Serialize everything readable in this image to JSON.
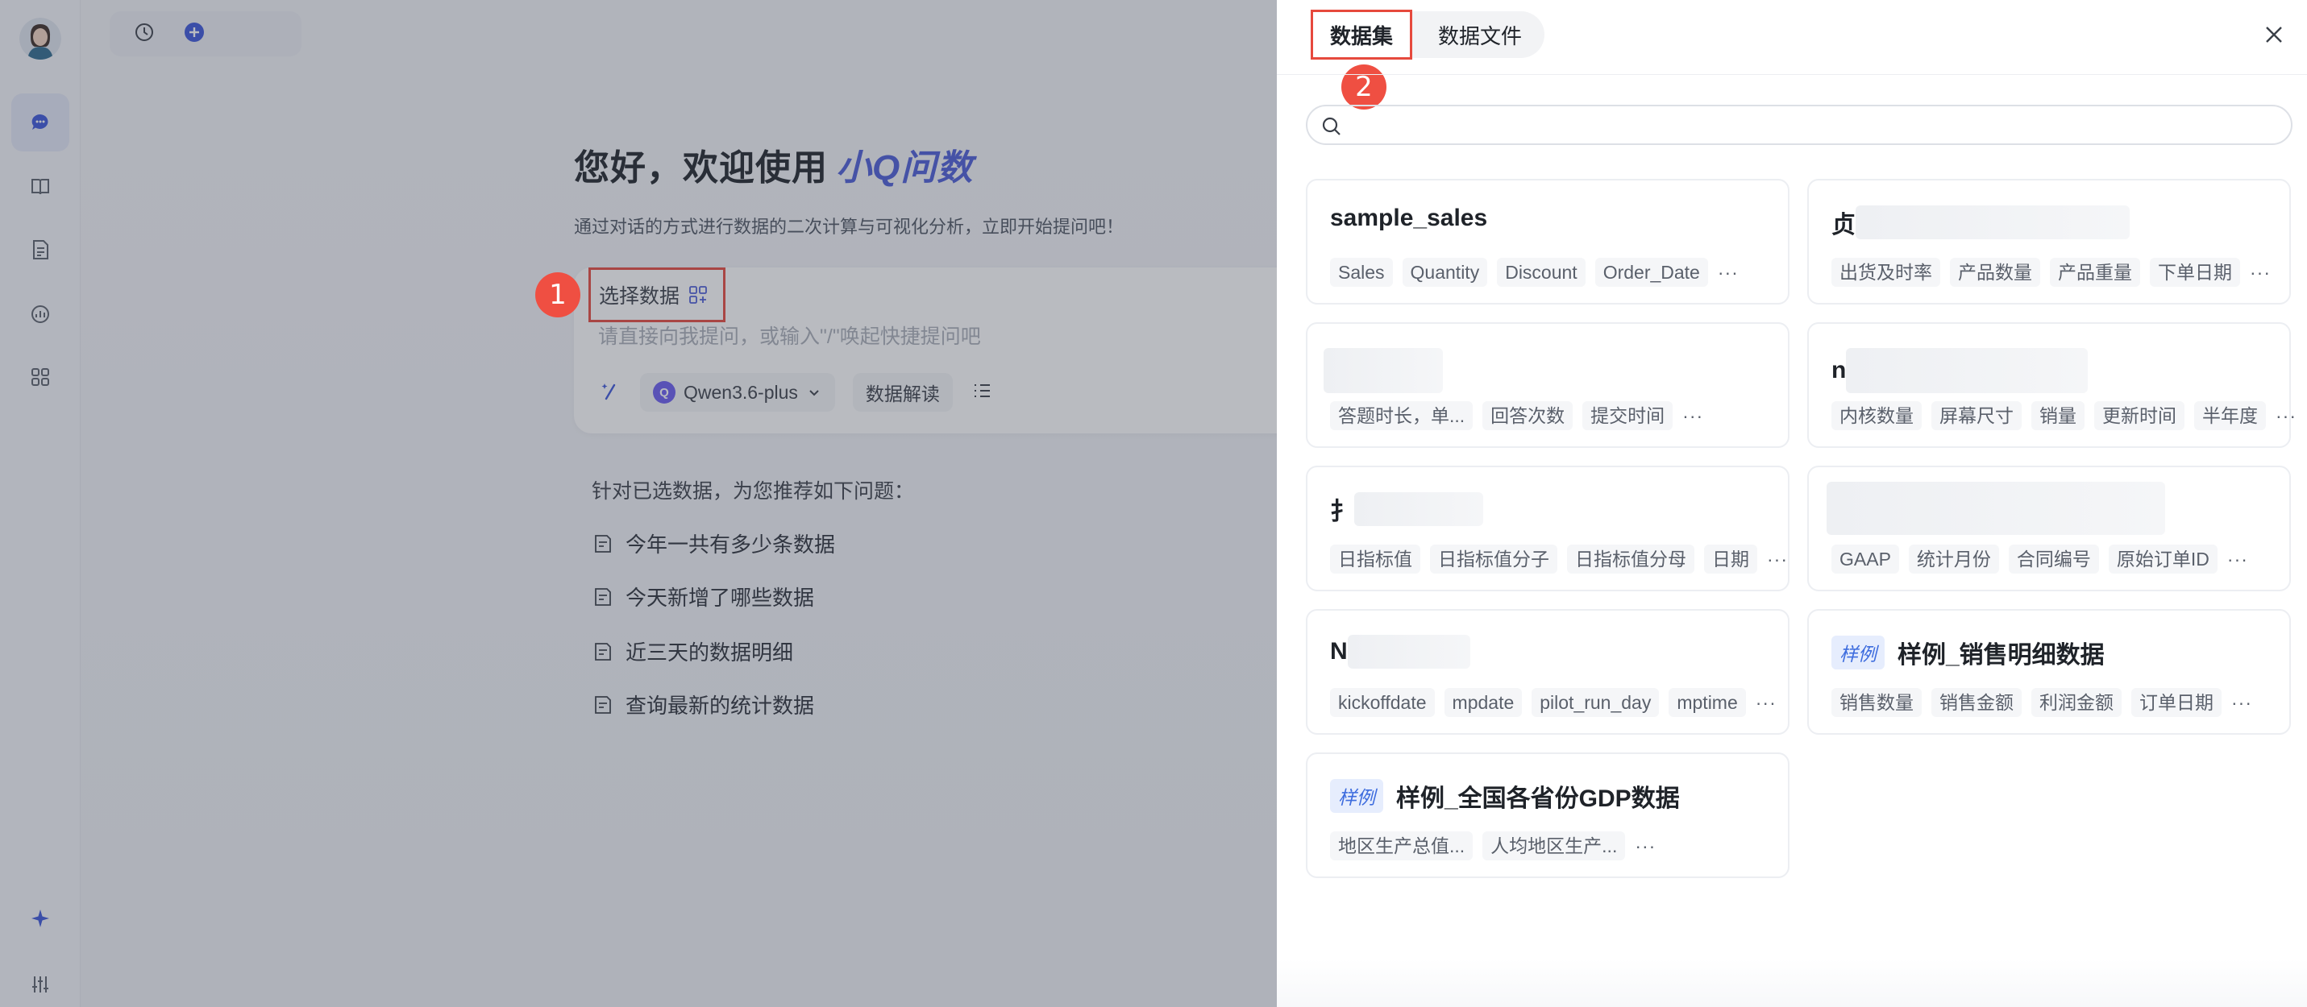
{
  "sidebar": {
    "items": [
      {
        "icon": "chat-icon",
        "active": true
      },
      {
        "icon": "book-icon"
      },
      {
        "icon": "report-icon"
      },
      {
        "icon": "analysis-icon"
      },
      {
        "icon": "apps-grid-icon"
      }
    ],
    "bottom": [
      {
        "icon": "sparkle-icon"
      },
      {
        "icon": "settings-sliders-icon"
      }
    ]
  },
  "topbar": {
    "icons": [
      "history-icon",
      "new-chat-icon"
    ]
  },
  "main": {
    "greeting": "您好，欢迎使用",
    "brand": "小Q问数",
    "subtitle": "通过对话的方式进行数据的二次计算与可视化分析，立即开始提问吧！",
    "select_data_label": "选择数据",
    "input_placeholder": "请直接向我提问，或输入\"/\"唤起快捷提问吧",
    "model_name": "Qwen3.6-plus",
    "interpret_label": "数据解读",
    "suggest_title": "针对已选数据，为您推荐如下问题：",
    "suggestions": [
      "今年一共有多少条数据",
      "今天新增了哪些数据",
      "近三天的数据明细",
      "查询最新的统计数据"
    ]
  },
  "badges": {
    "step1": "1",
    "step2": "2"
  },
  "drawer": {
    "tabs": [
      {
        "label": "数据集",
        "active": true
      },
      {
        "label": "数据文件",
        "active": false
      }
    ],
    "datasets": [
      {
        "title": "sample_sales",
        "sample": false,
        "tags": [
          "Sales",
          "Quantity",
          "Discount",
          "Order_Date"
        ],
        "more": "···"
      },
      {
        "title": "贞",
        "sample": false,
        "tags": [
          "出货及时率",
          "产品数量",
          "产品重量",
          "下单日期"
        ],
        "more": "···"
      },
      {
        "title": "",
        "sample": false,
        "tags": [
          "答题时长，单...",
          "回答次数",
          "提交时间"
        ],
        "more": "···"
      },
      {
        "title": "n",
        "sample": false,
        "tags": [
          "内核数量",
          "屏幕尺寸",
          "销量",
          "更新时间",
          "半年度"
        ],
        "more": "···"
      },
      {
        "title": "扌",
        "sample": false,
        "tags": [
          "日指标值",
          "日指标值分子",
          "日指标值分母",
          "日期"
        ],
        "more": "···"
      },
      {
        "title": "",
        "sample": false,
        "tags": [
          "GAAP",
          "统计月份",
          "合同编号",
          "原始订单ID"
        ],
        "more": "···"
      },
      {
        "title": "N",
        "sample": false,
        "tags": [
          "kickoffdate",
          "mpdate",
          "pilot_run_day",
          "mptime"
        ],
        "more": "···"
      },
      {
        "title": "样例_销售明细数据",
        "sample": true,
        "sample_label": "样例",
        "tags": [
          "销售数量",
          "销售金额",
          "利润金额",
          "订单日期"
        ],
        "more": "···"
      },
      {
        "title": "样例_全国各省份GDP数据",
        "sample": true,
        "sample_label": "样例",
        "tags": [
          "地区生产总值...",
          "人均地区生产..."
        ],
        "more": "···"
      }
    ]
  },
  "colors": {
    "accent": "#4a5bd6",
    "highlight_red": "#e6493d",
    "badge_red": "#ef4f42",
    "sample_blue": "#3d6cde"
  }
}
